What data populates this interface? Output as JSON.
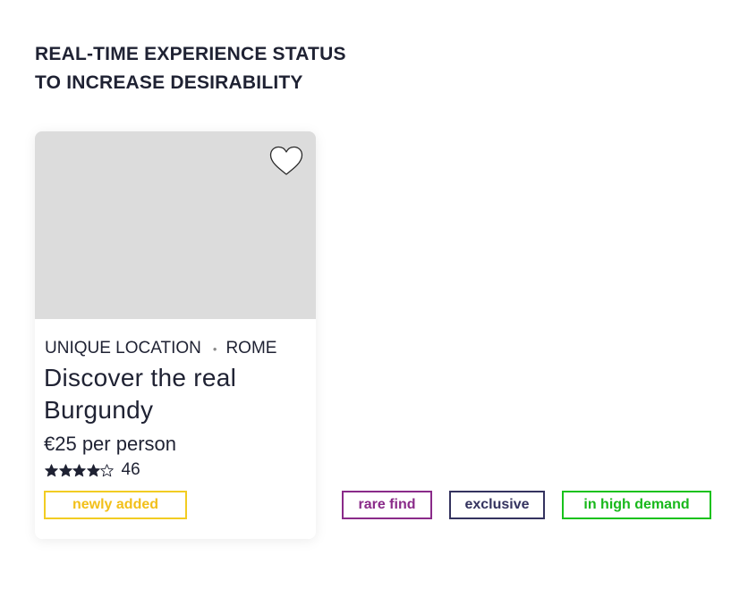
{
  "heading": {
    "line1": "REAL-TIME EXPERIENCE STATUS",
    "line2": "TO INCREASE DESIRABILITY"
  },
  "card": {
    "category": "UNIQUE LOCATION",
    "separator": "•",
    "city": "ROME",
    "title": "Discover the real Burgundy",
    "price": "€25 per person",
    "rating": {
      "stars_filled": 4,
      "stars_total": 5,
      "count": "46"
    },
    "favorite_icon": "heart-outline-icon"
  },
  "badges": {
    "newly_added": "newly added",
    "rare_find": "rare find",
    "exclusive": "exclusive",
    "in_high_demand": "in high demand"
  },
  "colors": {
    "text": "#1f2233",
    "newly_added": "#f2c01a",
    "rare_find": "#8a2b89",
    "exclusive": "#34335f",
    "in_high_demand": "#18b81b",
    "image_placeholder": "#dcdcdc"
  }
}
